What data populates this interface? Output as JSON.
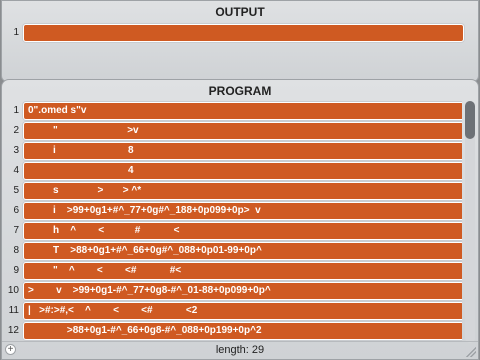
{
  "output": {
    "title": "OUTPUT",
    "rows": [
      {
        "num": "1",
        "text": ""
      }
    ]
  },
  "program": {
    "title": "PROGRAM",
    "rows": [
      {
        "num": "1",
        "text": "0\".omed s\"v"
      },
      {
        "num": "2",
        "text": "         \"                         >v"
      },
      {
        "num": "3",
        "text": "         i                          8"
      },
      {
        "num": "4",
        "text": "                                    4"
      },
      {
        "num": "5",
        "text": "         s              >       > ^*"
      },
      {
        "num": "6",
        "text": "         i    >99+0g1+#^_77+0g#^_188+0p099+0p>  v"
      },
      {
        "num": "7",
        "text": "         h    ^        <           #            <"
      },
      {
        "num": "8",
        "text": "         T    >88+0g1+#^_66+0g#^_088+0p01-99+0p^"
      },
      {
        "num": "9",
        "text": "         \"    ^        <        <#            #<"
      },
      {
        "num": "10",
        "text": ">        v    >99+0g1-#^_77+0g8-#^_01-88+0p099+0p^"
      },
      {
        "num": "11",
        "text": "|   >#:>#,<    ^        <        <#            <2"
      },
      {
        "num": "12",
        "text": "              >88+0g1-#^_66+0g8-#^_088+0p199+0p^2"
      }
    ],
    "scroll_fraction": 0.0
  },
  "footer": {
    "length_text": "length: 29",
    "add_glyph": "+"
  },
  "colors": {
    "row_fill": "#cf5a22",
    "background": "#8a8d90"
  }
}
